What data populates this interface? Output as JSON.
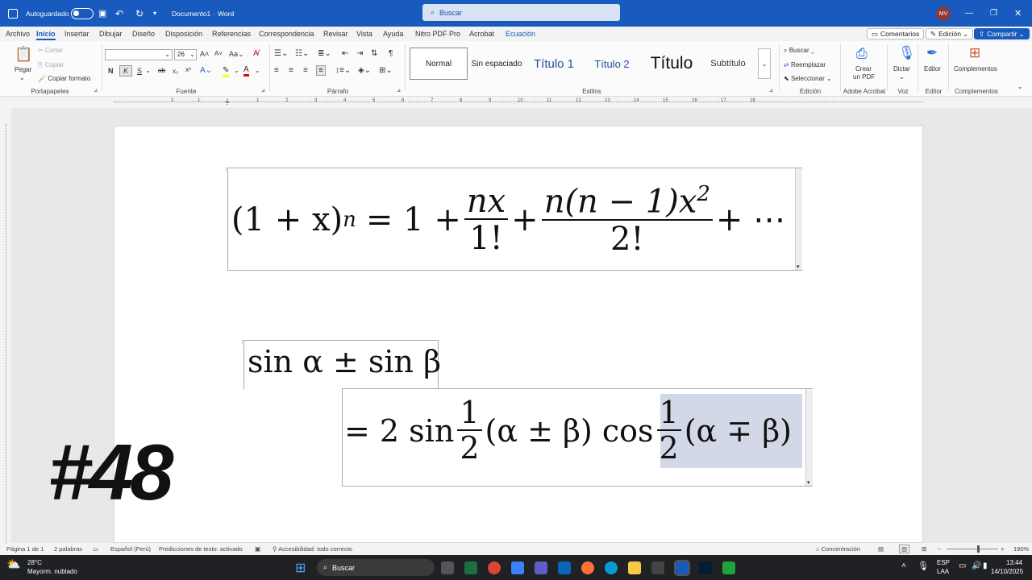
{
  "titlebar": {
    "autosave_label": "Autoguardado",
    "doc_title": "Documento1",
    "app_name": "Word",
    "search_placeholder": "Buscar",
    "avatar_initials": "MV"
  },
  "tabs": [
    "Archivo",
    "Inicio",
    "Insertar",
    "Dibujar",
    "Diseño",
    "Disposición",
    "Referencias",
    "Correspondencia",
    "Revisar",
    "Vista",
    "Ayuda",
    "Nitro PDF Pro",
    "Acrobat",
    "Ecuación"
  ],
  "top_buttons": {
    "comments": "Comentarios",
    "editing": "Edición",
    "share": "Compartir"
  },
  "ribbon": {
    "clipboard": {
      "paste": "Pegar",
      "cut": "Cortar",
      "copy": "Copiar",
      "format_painter": "Copiar formato",
      "label": "Portapapeles"
    },
    "font": {
      "font_size": "26",
      "label": "Fuente",
      "bold": "N",
      "italic": "K",
      "underline": "S"
    },
    "paragraph": {
      "label": "Párrafo"
    },
    "styles": {
      "items": [
        "Normal",
        "Sin espaciado",
        "Título 1",
        "Título 2",
        "Título",
        "Subtítulo"
      ],
      "label": "Estilos"
    },
    "editing": {
      "find": "Buscar",
      "replace": "Reemplazar",
      "select": "Seleccionar",
      "label": "Edición"
    },
    "acrobat": {
      "create": "Crear",
      "create2": "un PDF",
      "label": "Adobe Acrobat"
    },
    "voice": {
      "dictate": "Dictar",
      "label": "Voz"
    },
    "editor": {
      "name": "Editor",
      "label": "Editor"
    },
    "addins": {
      "name": "Complementos",
      "label": "Complementos"
    }
  },
  "ruler_numbers": [
    "1",
    "2",
    "1",
    "2",
    "3",
    "4",
    "5",
    "6",
    "7",
    "8",
    "9",
    "10",
    "11",
    "12",
    "13",
    "14",
    "15",
    "16",
    "17",
    "18"
  ],
  "document": {
    "eq1": {
      "lhs": "(1 + x)",
      "exp": "n",
      "eq": "= 1 +",
      "f1_num": "nx",
      "f1_den": "1!",
      "plus": "+",
      "f2_num": "n(n − 1)x",
      "f2_exp": "2",
      "f2_den": "2!",
      "tail": "+ ⋯"
    },
    "eq2": {
      "line1": "sin α ± sin β",
      "eq": "= 2 sin",
      "half_num": "1",
      "half_den": "2",
      "arg1": "(α ± β) cos",
      "arg2": "(α ∓ β)"
    },
    "episode": "#48"
  },
  "status": {
    "page": "Página 1 de 1",
    "words": "2 palabras",
    "language": "Español (Perú)",
    "predictions": "Predicciones de texto: activado",
    "accessibility": "Accesibilidad: todo correcto",
    "focus": "Concentración",
    "zoom": "190%"
  },
  "taskbar": {
    "temperature": "28°C",
    "weather": "Mayorm. nublado",
    "search": "Buscar",
    "lang1": "ESP",
    "lang2": "LAA",
    "time": "13:44",
    "date": "14/10/2025"
  },
  "colors": {
    "word_blue": "#185abd",
    "selection": "#d3d8e8"
  }
}
